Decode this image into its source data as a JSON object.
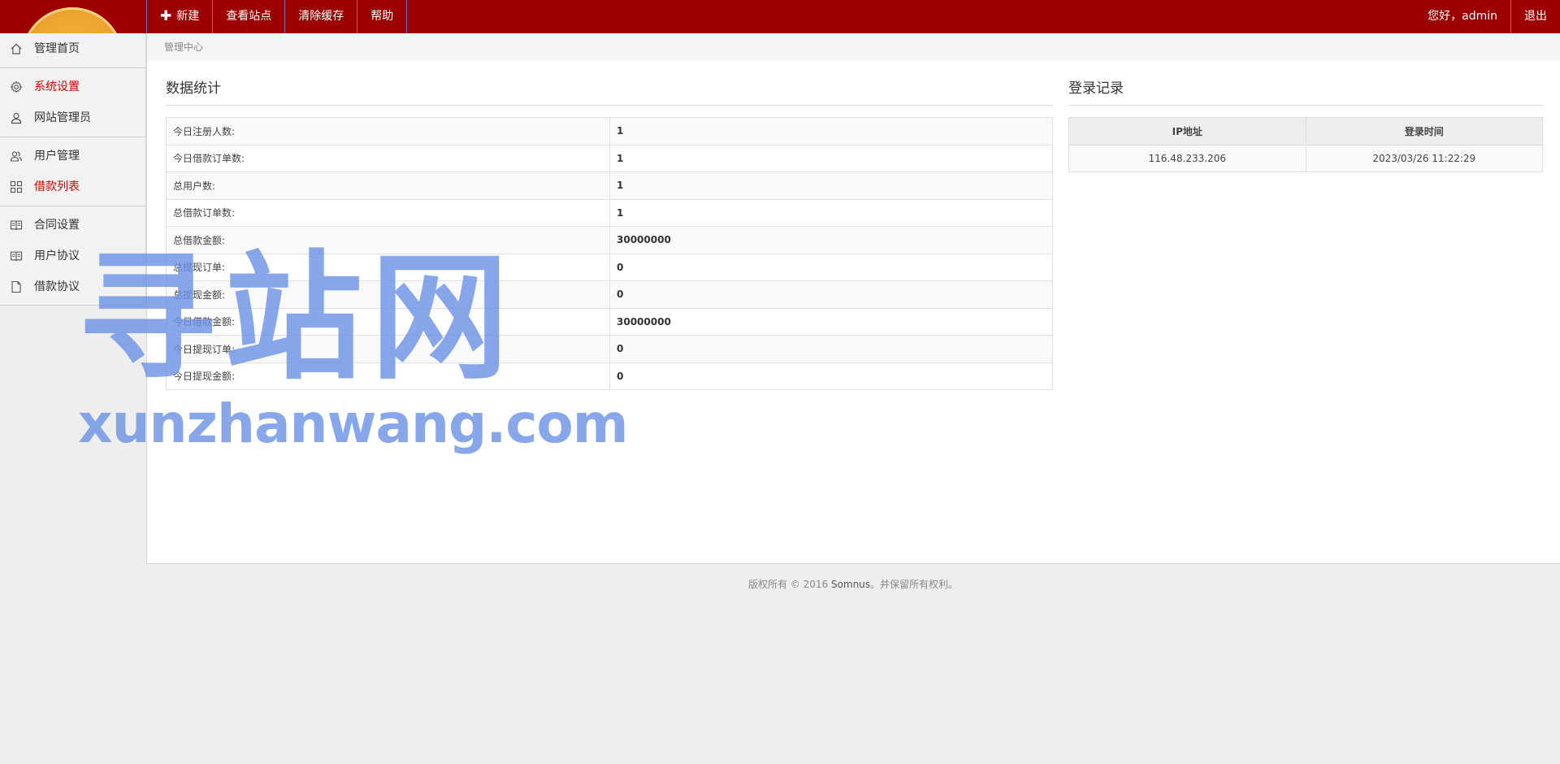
{
  "topbar": {
    "nav": [
      {
        "label": "新建",
        "icon": "plus-icon"
      },
      {
        "label": "查看站点"
      },
      {
        "label": "清除缓存"
      },
      {
        "label": "帮助"
      }
    ],
    "greeting": "您好，admin",
    "logout": "退出"
  },
  "sidebar": {
    "items": [
      {
        "label": "管理首页",
        "icon": "home-icon",
        "active": false
      },
      {
        "label": "系统设置",
        "icon": "gear-icon",
        "active": true
      },
      {
        "label": "网站管理员",
        "icon": "user-icon",
        "active": false
      },
      {
        "label": "用户管理",
        "icon": "users-icon",
        "active": false
      },
      {
        "label": "借款列表",
        "icon": "grid-icon",
        "active": true
      },
      {
        "label": "合同设置",
        "icon": "book-icon",
        "active": false
      },
      {
        "label": "用户协议",
        "icon": "book-icon",
        "active": false
      },
      {
        "label": "借款协议",
        "icon": "file-icon",
        "active": false
      }
    ]
  },
  "breadcrumb": "管理中心",
  "stats": {
    "title": "数据统计",
    "rows": [
      {
        "label": "今日注册人数:",
        "value": "1"
      },
      {
        "label": "今日借款订单数:",
        "value": "1"
      },
      {
        "label": "总用户数:",
        "value": "1"
      },
      {
        "label": "总借款订单数:",
        "value": "1"
      },
      {
        "label": "总借款金额:",
        "value": "30000000"
      },
      {
        "label": "总提现订单:",
        "value": "0"
      },
      {
        "label": "总提现金额:",
        "value": "0"
      },
      {
        "label": "今日借款金额:",
        "value": "30000000"
      },
      {
        "label": "今日提现订单:",
        "value": "0"
      },
      {
        "label": "今日提现金额:",
        "value": "0"
      }
    ]
  },
  "login": {
    "title": "登录记录",
    "headers": [
      "IP地址",
      "登录时间"
    ],
    "rows": [
      {
        "ip": "116.48.233.206",
        "time": "2023/03/26 11:22:29"
      }
    ]
  },
  "footer": {
    "prefix": "版权所有 © 2016 ",
    "brand": "Somnus",
    "suffix": "。并保留所有权利。"
  },
  "watermark": {
    "cn": "寻站网",
    "en": "xunzhanwang.com"
  },
  "colors": {
    "topbar": "#9c0000",
    "active": "#d40000",
    "watermark": "#6f93e6"
  }
}
